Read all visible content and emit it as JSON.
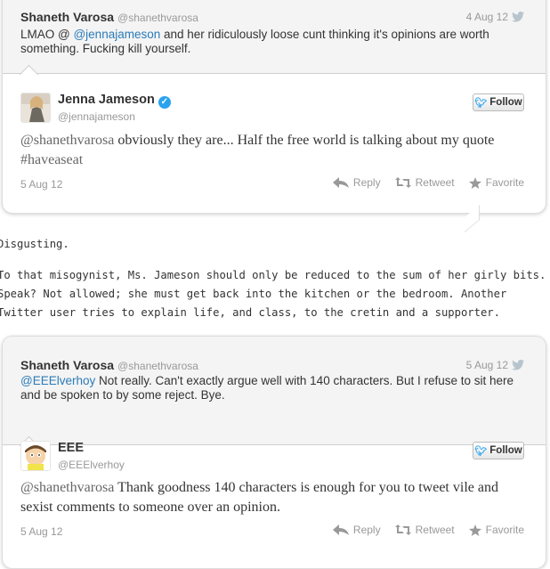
{
  "card1": {
    "reply": {
      "name": "Shaneth Varosa",
      "handle": "@shanethvarosa",
      "date": "4 Aug 12",
      "text_prefix": "LMAO @ ",
      "mention": "@jennajameson",
      "text_suffix": " and her ridiculously loose cunt thinking it's opinions are worth something. Fucking kill yourself."
    },
    "tweet": {
      "name": "Jenna Jameson",
      "handle": "@jennajameson",
      "follow_label": "Follow",
      "mention": "@shanethvarosa",
      "text_mid": " obviously they are... Half the free world is talking about my quote ",
      "hashtag": "#haveaseat",
      "date": "5 Aug 12",
      "reply_label": "Reply",
      "retweet_label": "Retweet",
      "favorite_label": "Favorite"
    }
  },
  "paragraphs": {
    "p1": "Disgusting.",
    "p2": "To that misogynist, Ms. Jameson should only be reduced to the sum of her girly bits. Speak? Not allowed; she must get back into the kitchen or the bedroom. Another Twitter user tries to explain life, and class, to the cretin and a supporter."
  },
  "card2": {
    "reply": {
      "name": "Shaneth Varosa",
      "handle": "@shanethvarosa",
      "date": "5 Aug 12",
      "mention": "@EEElverhoy",
      "text_suffix": " Not really. Can't exactly argue well with 140 characters. But I refuse to sit here and be spoken to by some reject. Bye."
    },
    "tweet": {
      "name": "EEE",
      "handle": "@EEElverhoy",
      "follow_label": "Follow",
      "mention": "@shanethvarosa",
      "text_rest": " Thank goodness 140 characters is enough for you to tweet vile and sexist comments to someone over an opinion.",
      "date": "5 Aug 12",
      "reply_label": "Reply",
      "retweet_label": "Retweet",
      "favorite_label": "Favorite"
    }
  },
  "colors": {
    "link": "#2b7bb9",
    "verified": "#2aa3ef",
    "muted": "#999999"
  }
}
